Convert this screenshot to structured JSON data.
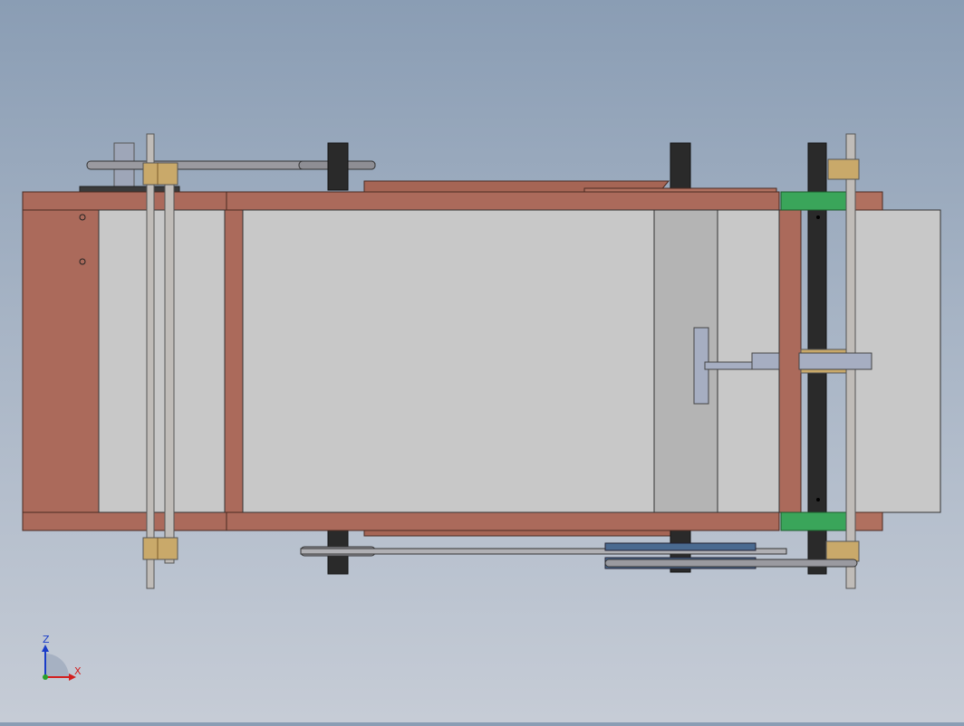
{
  "viewport": {
    "background_top": "#8a9db4",
    "background_bottom": "#c6ccd6"
  },
  "colors": {
    "frame": "#ab6a5b",
    "frame_edge": "#4a2a22",
    "panel": "#c8c8c8",
    "panel_dark": "#b4b4b4",
    "shaft": "#c0bcb8",
    "roller": "#2a2a2a",
    "collar": "#c9a96a",
    "bracket_green": "#3aa55a",
    "belt": "#9a9aa0",
    "slider": "#a6aec2",
    "pulley_blue": "#4a6a90"
  },
  "triad": {
    "z_label": "Z",
    "x_label": "X",
    "z_color": "#1a3cc8",
    "x_color": "#d21e1e"
  }
}
